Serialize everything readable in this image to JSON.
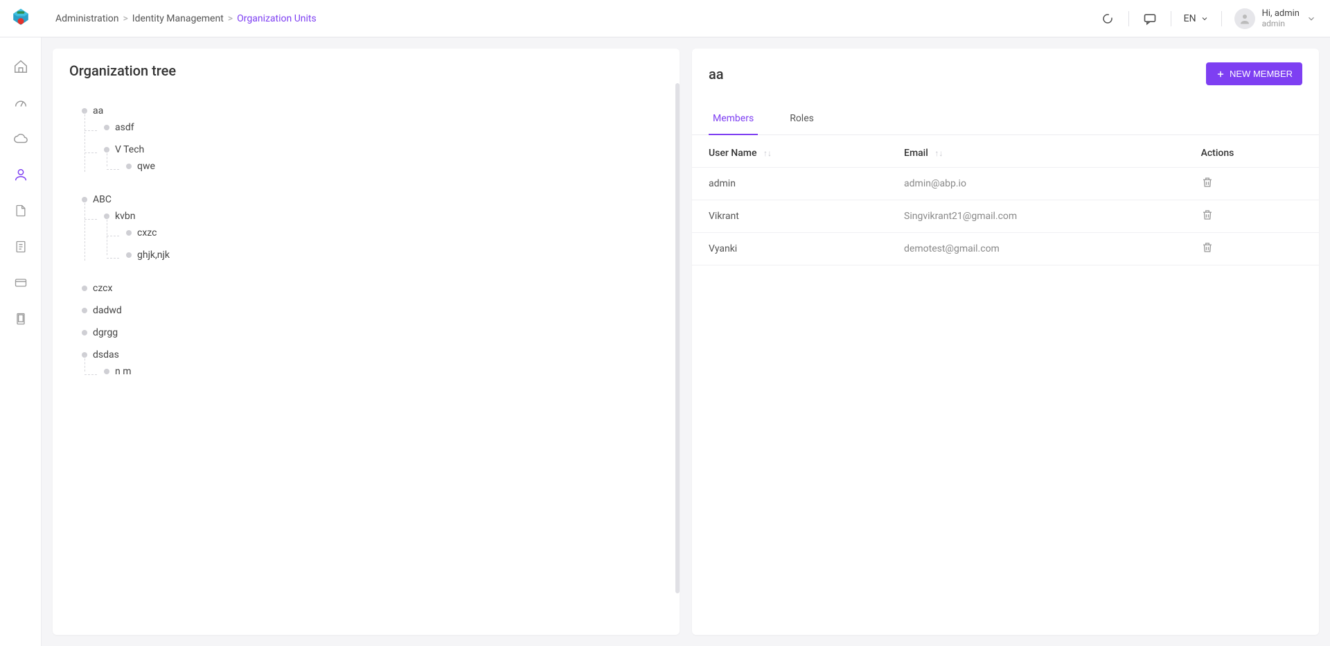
{
  "breadcrumb": {
    "items": [
      "Administration",
      "Identity Management",
      "Organization Units"
    ]
  },
  "header": {
    "language": "EN",
    "greeting": "Hi, admin",
    "username": "admin"
  },
  "sidebar": {
    "items": [
      {
        "name": "home-icon"
      },
      {
        "name": "dashboard-icon"
      },
      {
        "name": "cloud-icon"
      },
      {
        "name": "user-icon",
        "active": true
      },
      {
        "name": "file-icon"
      },
      {
        "name": "document-icon"
      },
      {
        "name": "card-icon"
      },
      {
        "name": "tablet-icon"
      }
    ]
  },
  "left_panel": {
    "title": "Organization tree",
    "tree": [
      {
        "label": "aa",
        "children": [
          {
            "label": "asdf"
          },
          {
            "label": "V Tech",
            "children": [
              {
                "label": "qwe"
              }
            ]
          }
        ]
      },
      {
        "label": "ABC",
        "children": [
          {
            "label": "kvbn",
            "children": [
              {
                "label": "cxzc"
              },
              {
                "label": "ghjk,njk"
              }
            ]
          }
        ]
      },
      {
        "label": "czcx"
      },
      {
        "label": "dadwd"
      },
      {
        "label": "dgrgg"
      },
      {
        "label": "dsdas",
        "children": [
          {
            "label": "n m"
          }
        ]
      }
    ]
  },
  "right_panel": {
    "title": "aa",
    "new_member_label": "NEW MEMBER",
    "tabs": [
      {
        "label": "Members",
        "active": true
      },
      {
        "label": "Roles",
        "active": false
      }
    ],
    "columns": {
      "username": "User Name",
      "email": "Email",
      "actions": "Actions"
    },
    "rows": [
      {
        "username": "admin",
        "email": "admin@abp.io"
      },
      {
        "username": "Vikrant",
        "email": "Singvikrant21@gmail.com"
      },
      {
        "username": "Vyanki",
        "email": "demotest@gmail.com"
      }
    ]
  }
}
